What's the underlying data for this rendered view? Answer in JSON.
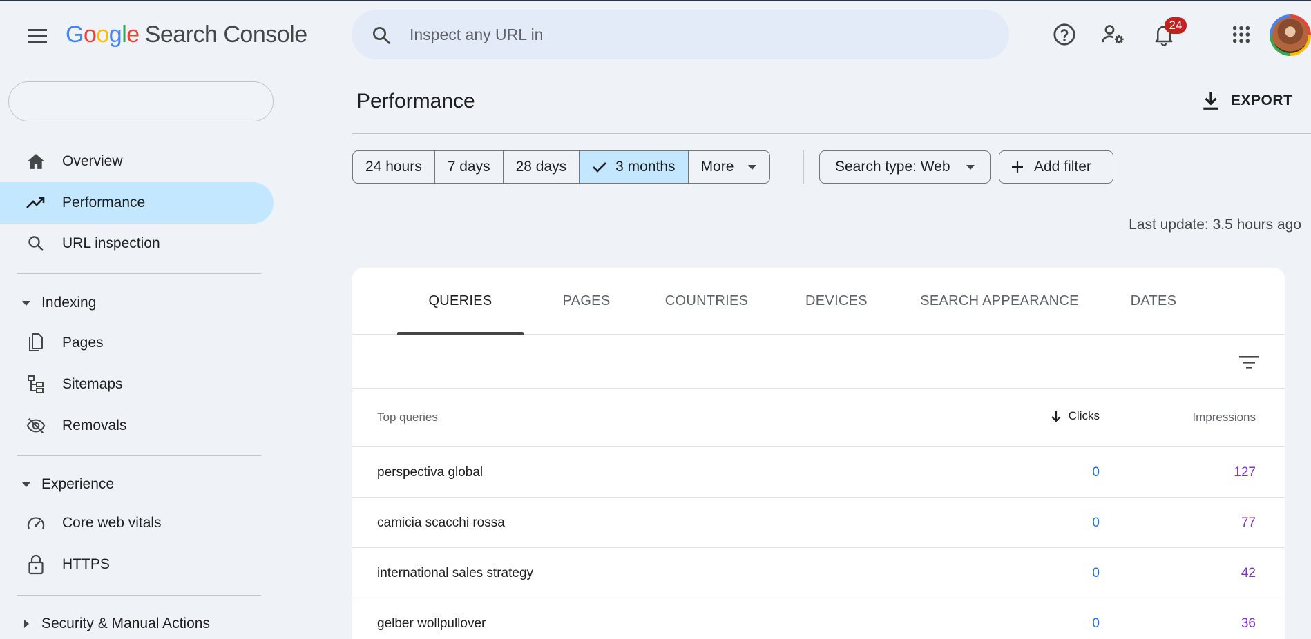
{
  "app": {
    "logo_letters": [
      "G",
      "o",
      "o",
      "g",
      "l",
      "e"
    ],
    "product": "Search Console"
  },
  "search": {
    "placeholder": "Inspect any URL in"
  },
  "header": {
    "notification_count": "24"
  },
  "sidebar": {
    "property_value": "",
    "items_top": [
      {
        "label": "Overview",
        "icon": "home-icon",
        "active": false
      },
      {
        "label": "Performance",
        "icon": "trending-up-icon",
        "active": true
      },
      {
        "label": "URL inspection",
        "icon": "search-icon",
        "active": false
      }
    ],
    "sections": [
      {
        "label": "Indexing",
        "expanded": true,
        "items": [
          "Pages",
          "Sitemaps",
          "Removals"
        ]
      },
      {
        "label": "Experience",
        "expanded": true,
        "items": [
          "Core web vitals",
          "HTTPS"
        ]
      },
      {
        "label": "Security & Manual Actions",
        "expanded": false,
        "items": []
      }
    ]
  },
  "main": {
    "title": "Performance",
    "export_label": "EXPORT",
    "date_ranges": [
      "24 hours",
      "7 days",
      "28 days",
      "3 months",
      "More"
    ],
    "selected_range": "3 months",
    "search_type_label": "Search type: Web",
    "add_filter_label": "Add filter",
    "last_update": "Last update: 3.5 hours ago",
    "tabs": [
      "QUERIES",
      "PAGES",
      "COUNTRIES",
      "DEVICES",
      "SEARCH APPEARANCE",
      "DATES"
    ],
    "active_tab": "QUERIES",
    "table": {
      "headers": {
        "query": "Top queries",
        "clicks": "Clicks",
        "impressions": "Impressions"
      },
      "sort": "clicks-descending",
      "rows": [
        {
          "query": "perspectiva global",
          "clicks": "0",
          "impressions": "127"
        },
        {
          "query": "camicia scacchi rossa",
          "clicks": "0",
          "impressions": "77"
        },
        {
          "query": "international sales strategy",
          "clicks": "0",
          "impressions": "42"
        },
        {
          "query": "gelber wollpullover",
          "clicks": "0",
          "impressions": "36"
        }
      ]
    }
  },
  "colors": {
    "background": "#eff3f8",
    "active_nav": "#c2e7ff",
    "search_bar": "#e3eaf8",
    "clicks": "#1a73e8",
    "impressions": "#8430ce",
    "badge": "#c5221f"
  }
}
